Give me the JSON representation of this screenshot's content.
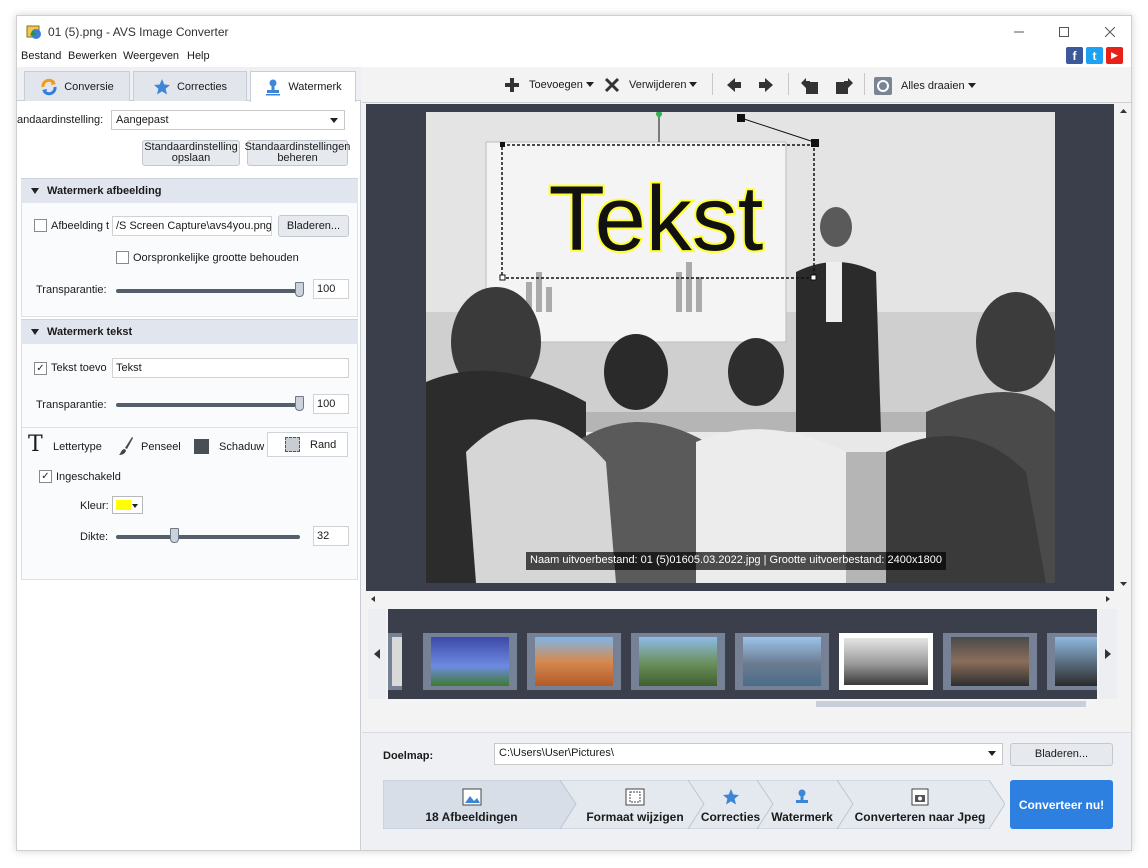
{
  "window": {
    "title": "01 (5).png - AVS Image Converter"
  },
  "menu": {
    "items": [
      "Bestand",
      "Bewerken",
      "Weergeven",
      "Help"
    ]
  },
  "social": {
    "facebook": "f",
    "twitter": "t",
    "youtube": "▶"
  },
  "tabs": [
    {
      "label": "Conversie",
      "icon": "refresh-icon"
    },
    {
      "label": "Correcties",
      "icon": "star-icon"
    },
    {
      "label": "Watermerk",
      "icon": "stamp-icon"
    }
  ],
  "left": {
    "preset_label": "andaardinstelling:",
    "preset_value": "Aangepast",
    "save_preset": [
      "Standaardinstelling",
      "opslaan"
    ],
    "manage_presets": [
      "Standaardinstellingen",
      "beheren"
    ],
    "image_section": "Watermerk afbeelding",
    "image_checkbox_label": "Afbeelding t",
    "image_path": "/S Screen Capture\\avs4you.png",
    "browse_label": "Bladeren...",
    "keep_size_label": "Oorspronkelijke grootte behouden",
    "image_transparency_label": "Transparantie:",
    "image_transparency_value": "100",
    "image_transparency_level": 1.0,
    "text_section": "Watermerk tekst",
    "text_checkbox_label": "Tekst toevo",
    "text_value": "Tekst",
    "text_transparency_label": "Transparantie:",
    "text_transparency_value": "100",
    "text_transparency_level": 1.0,
    "style_tabs": {
      "font": "Lettertype",
      "brush": "Penseel",
      "shadow": "Schaduw",
      "border": "Rand"
    },
    "enabled_label": "Ingeschakeld",
    "color_label": "Kleur:",
    "color_value": "#ffff00",
    "thickness_label": "Dikte:",
    "thickness_value": "32",
    "thickness_level": 0.32
  },
  "toolbar": {
    "add": "Toevoegen",
    "remove": "Verwijderen",
    "rotate_all": "Alles draaien"
  },
  "preview": {
    "watermark_text": "Tekst",
    "watermark_color": "#ffff33",
    "caption": "Naam uitvoerbestand: 01 (5)01605.03.2022.jpg | Grootte uitvoerbestand: 2400x1800"
  },
  "bottom": {
    "target_label": "Doelmap:",
    "target_path": "C:\\Users\\User\\Pictures\\",
    "browse_label": "Bladeren...",
    "steps": [
      {
        "label": "18 Afbeeldingen",
        "icon": "image-icon"
      },
      {
        "label": "Formaat wijzigen",
        "icon": "resize-icon"
      },
      {
        "label": "Correcties",
        "icon": "star-icon"
      },
      {
        "label": "Watermerk",
        "icon": "stamp-icon"
      },
      {
        "label": "Converteren naar Jpeg",
        "icon": "camera-icon"
      }
    ],
    "convert_label": "Converteer nu!"
  },
  "colors": {
    "accent": "#2d7fe0",
    "preview_bg": "#3a3f4b"
  }
}
